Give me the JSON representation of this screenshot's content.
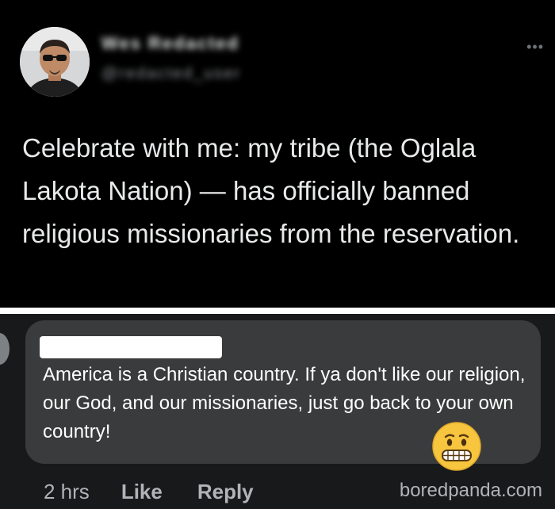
{
  "tweet": {
    "display_name": "Wes Redacted",
    "handle": "@redacted_user",
    "text": "Celebrate with me: my tribe (the Oglala Lakota Nation) — has officially banned religious missionaries from the reservation.",
    "more_icon": "more-horizontal-icon"
  },
  "comment": {
    "text": "America is a Christian country. If ya don't like our religion, our God, and our missionaries, just go back to your own country!",
    "emoji": "grimacing-face-icon",
    "time": "2 hrs",
    "like_label": "Like",
    "reply_label": "Reply"
  },
  "watermark": "boredpanda.com",
  "colors": {
    "tweet_bg": "#000000",
    "comment_bg": "#18191a",
    "bubble_bg": "#3a3b3c",
    "meta_text": "#b0b3b8"
  }
}
